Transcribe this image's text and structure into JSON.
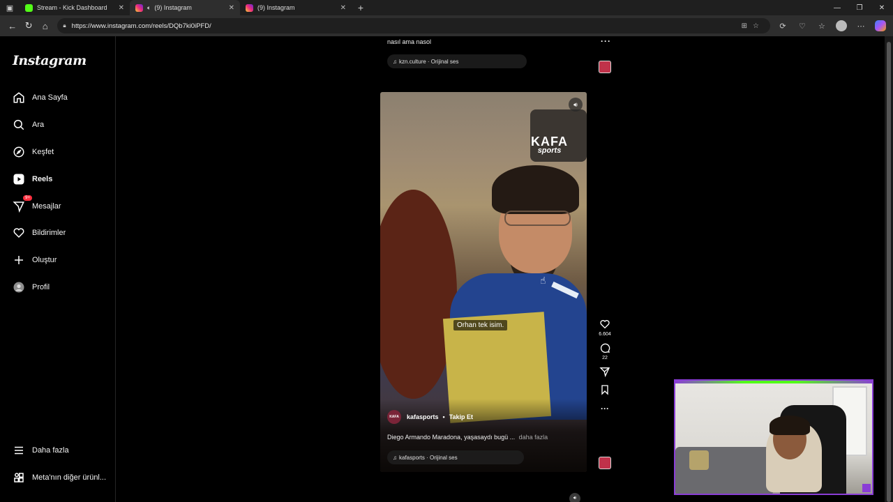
{
  "browser": {
    "tabs": [
      {
        "title": "Stream - Kick Dashboard",
        "favicon": "kick-icon",
        "active": false,
        "audio": false
      },
      {
        "title": "(9) Instagram",
        "favicon": "instagram-icon",
        "active": true,
        "audio": true
      },
      {
        "title": "(9) Instagram",
        "favicon": "instagram-icon",
        "active": false,
        "audio": false
      }
    ],
    "url": "https://www.instagram.com/reels/DQb7ki0iPFD/"
  },
  "sidebar": {
    "logo": "Instagram",
    "items": [
      {
        "label": "Ana Sayfa",
        "icon": "home-icon"
      },
      {
        "label": "Ara",
        "icon": "search-icon"
      },
      {
        "label": "Keşfet",
        "icon": "compass-icon"
      },
      {
        "label": "Reels",
        "icon": "reels-icon"
      },
      {
        "label": "Mesajlar",
        "icon": "messenger-icon",
        "badge": "9+"
      },
      {
        "label": "Bildirimler",
        "icon": "heart-icon"
      },
      {
        "label": "Oluştur",
        "icon": "plus-icon"
      },
      {
        "label": "Profil",
        "icon": "profile-icon"
      }
    ],
    "bottom": [
      {
        "label": "Daha fazla",
        "icon": "menu-icon"
      },
      {
        "label": "Meta'nın diğer ürünl...",
        "icon": "meta-apps-icon"
      }
    ]
  },
  "previous_reel": {
    "caption": "nasıl ama nasol",
    "audio": "kzn.culture · Orijinal ses"
  },
  "reel": {
    "watermark_line1": "KAFA",
    "watermark_line2": "sports",
    "subtitle": "Orhan tek isim.",
    "username": "kafasports",
    "follow": "Takip Et",
    "avatar_text": "KAFA",
    "caption": "Diego Armando Maradona, yaşasaydı bugü ...",
    "caption_more": "daha fazla",
    "audio": "kafasports · Orijinal ses",
    "likes": "6.604",
    "comments": "22"
  },
  "colors": {
    "accent_kick": "#53fc18",
    "badge": "#ff3040",
    "webcam_border": "#8a3dd6"
  }
}
